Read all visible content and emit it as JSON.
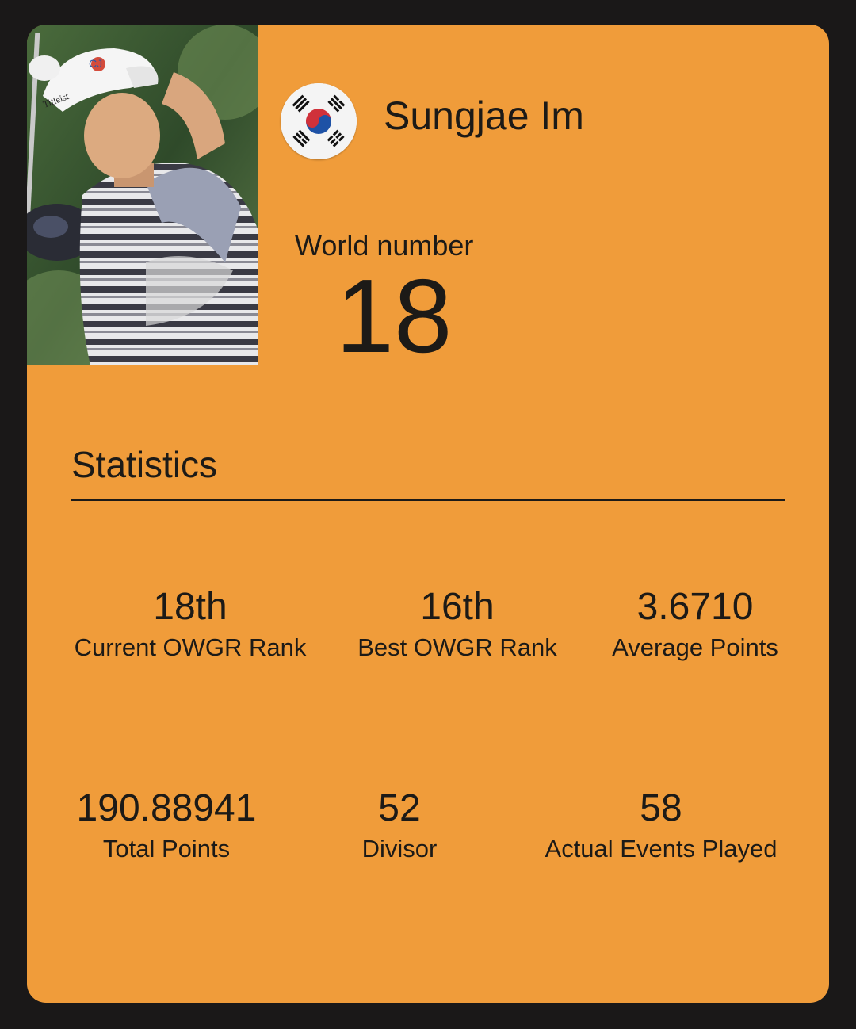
{
  "player": {
    "name": "Sungjae Im",
    "flag_icon": "south-korea-flag-icon",
    "photo_caption_marks": [
      "CJ",
      "Titleist"
    ]
  },
  "world": {
    "label": "World number",
    "rank": "18"
  },
  "statistics": {
    "title": "Statistics",
    "items": [
      {
        "value": "18th",
        "label": "Current OWGR Rank"
      },
      {
        "value": "16th",
        "label": "Best OWGR Rank"
      },
      {
        "value": "3.6710",
        "label": "Average Points"
      },
      {
        "value": "190.88941",
        "label": "Total Points"
      },
      {
        "value": "52",
        "label": "Divisor"
      },
      {
        "value": "58",
        "label": "Actual Events Played"
      }
    ]
  },
  "colors": {
    "background": "#1a1818",
    "card": "#f09c3a",
    "text": "#1c1a17"
  }
}
